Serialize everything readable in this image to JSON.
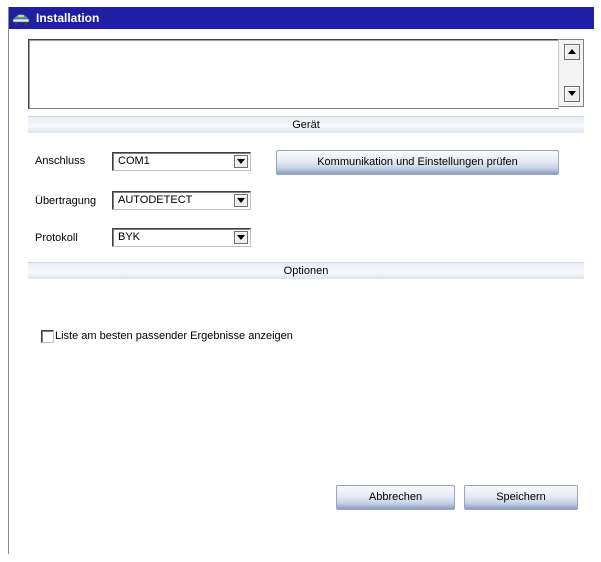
{
  "window": {
    "title": "Installation",
    "icon": "installation-app-icon"
  },
  "log": {
    "value": ""
  },
  "sections": {
    "device": "Gerät",
    "options": "Optionen"
  },
  "device": {
    "connection_label": "Anschluss",
    "connection_value": "COM1",
    "transfer_label": "Übertragung",
    "transfer_value": "AUTODETECT",
    "protocol_label": "Protokoll",
    "protocol_value": "BYK",
    "test_button": "Kommunikation und Einstellungen prüfen"
  },
  "options": {
    "show_best_matches_label": "Liste am besten passender Ergebnisse anzeigen",
    "show_best_matches_checked": false
  },
  "footer": {
    "cancel_label": "Abbrechen",
    "save_label": "Speichern"
  },
  "colors": {
    "titlebar": "#1f1fa3",
    "button_gradient_bottom": "#8c9dbd",
    "section_header": "#e6ecf6"
  }
}
